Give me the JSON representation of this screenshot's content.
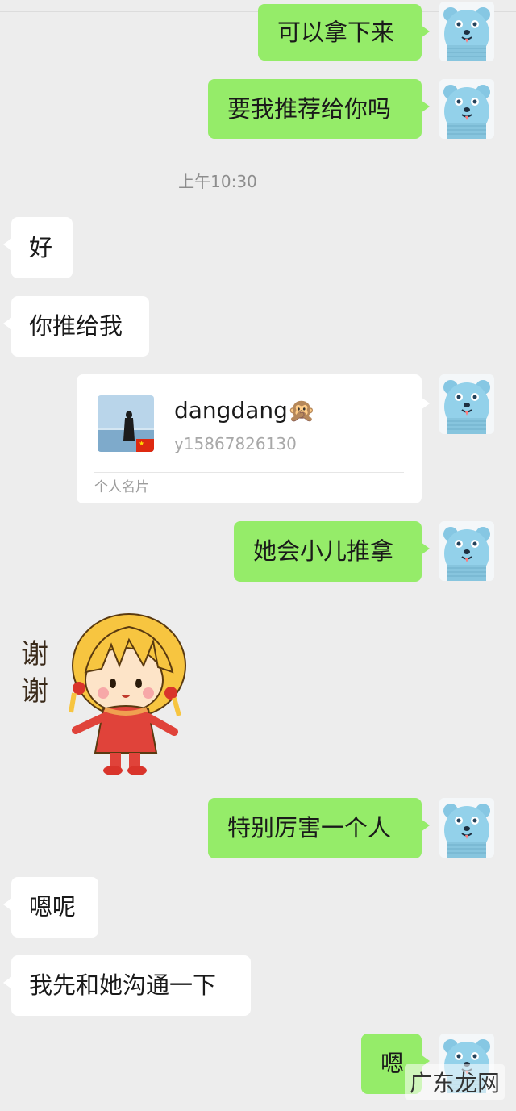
{
  "messages": {
    "m1": "可以拿下来",
    "m2": "要我推荐给你吗",
    "m3": "好",
    "m4": "你推给我",
    "m5": "她会小儿推拿",
    "m6": "特别厉害一个人",
    "m7": "嗯呢",
    "m8": "我先和她沟通一下",
    "m9": "嗯"
  },
  "timestamp": "上午10:30",
  "contact_card": {
    "name": "dangdang",
    "name_emoji": "🙊",
    "wechat_id": "y15867826130",
    "footer": "个人名片",
    "flag_icon": "china-flag-icon"
  },
  "sticker": {
    "text_line1": "谢",
    "text_line2": "谢"
  },
  "watermark": "广东龙网",
  "colors": {
    "background": "#ededed",
    "self_bubble": "#95ec69",
    "other_bubble": "#ffffff",
    "time_text": "#8d8d8d"
  },
  "icons": {
    "self_avatar": "blue-bear-avatar"
  }
}
